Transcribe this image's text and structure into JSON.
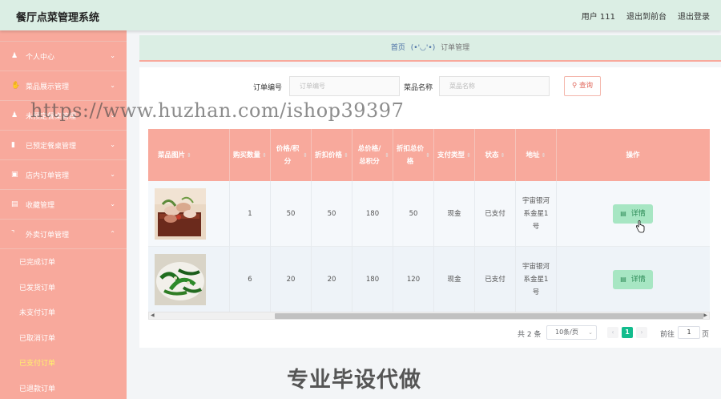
{
  "app": {
    "title": "餐厅点菜管理系统",
    "user_label": "用户 111",
    "back_front_label": "退出到前台",
    "logout_label": "退出登录"
  },
  "sidebar": {
    "items": [
      {
        "label": "个人中心",
        "icon": "user-icon"
      },
      {
        "label": "菜品展示管理",
        "icon": "thumbs-up-icon"
      },
      {
        "label": "未预定餐桌管理",
        "icon": "user-icon"
      },
      {
        "label": "已预定餐桌管理",
        "icon": "bar-chart-icon"
      },
      {
        "label": "店内订单管理",
        "icon": "monitor-icon"
      },
      {
        "label": "收藏管理",
        "icon": "chat-icon"
      },
      {
        "label": "外卖订单管理",
        "icon": "crop-icon"
      }
    ],
    "subitems": [
      {
        "label": "已完成订单",
        "active": false
      },
      {
        "label": "已发货订单",
        "active": false
      },
      {
        "label": "未支付订单",
        "active": false
      },
      {
        "label": "已取消订单",
        "active": false
      },
      {
        "label": "已支付订单",
        "active": true
      },
      {
        "label": "已退款订单",
        "active": false
      }
    ]
  },
  "breadcrumb": {
    "home": "首页",
    "separator": "(•'◡'•)",
    "current": "订单管理"
  },
  "search": {
    "order_no_label": "订单编号",
    "order_no_placeholder": "订单编号",
    "dish_label": "菜品名称",
    "dish_placeholder": "菜品名称",
    "query_label": "查询"
  },
  "table": {
    "headers": [
      "菜品图片",
      "购买数量",
      "价格/积分",
      "折扣价格",
      "总价格/总积分",
      "折扣总价格",
      "支付类型",
      "状态",
      "地址",
      "操作"
    ],
    "rows": [
      {
        "image": "dish-photo-1",
        "qty": "1",
        "price": "50",
        "discount_price": "50",
        "total": "180",
        "discount_total": "50",
        "pay_type": "现金",
        "status": "已支付",
        "address": "宇宙银河系金星1号",
        "action": "详情"
      },
      {
        "image": "dish-photo-2",
        "qty": "6",
        "price": "20",
        "discount_price": "20",
        "total": "180",
        "discount_total": "120",
        "pay_type": "现金",
        "status": "已支付",
        "address": "宇宙银河系金星1号",
        "action": "详情"
      }
    ]
  },
  "pager": {
    "total": "共 2 条",
    "page_size": "10条/页",
    "current_page": "1",
    "goto_label": "前往",
    "goto_value": "1",
    "page_suffix": "页"
  },
  "watermark": {
    "url": "https://www.huzhan.com/ishop39397",
    "cta": "专业毕设代做"
  },
  "colors": {
    "topbar": "#dbeee4",
    "sidebar": "#f8a99c",
    "accent_green": "#12bc8d",
    "detail_button": "#a7e6c3"
  }
}
